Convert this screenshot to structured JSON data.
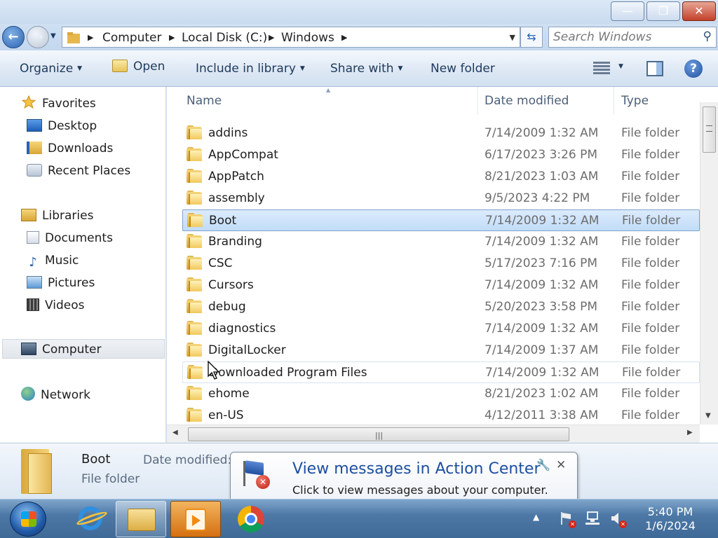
{
  "titlebar": {
    "minimize_label": "—",
    "maximize_label": "❐",
    "close_label": "✕"
  },
  "address": {
    "back_glyph": "←",
    "forward_glyph": "→",
    "crumbs": [
      "Computer",
      "Local Disk (C:)",
      "Windows"
    ],
    "search_placeholder": "Search Windows"
  },
  "toolbar": {
    "organize": "Organize",
    "open": "Open",
    "include_in_library": "Include in library",
    "share_with": "Share with",
    "new_folder": "New folder",
    "help": "?"
  },
  "nav": {
    "favorites": "Favorites",
    "desktop": "Desktop",
    "downloads": "Downloads",
    "recent_places": "Recent Places",
    "libraries": "Libraries",
    "documents": "Documents",
    "music": "Music",
    "pictures": "Pictures",
    "videos": "Videos",
    "computer": "Computer",
    "network": "Network"
  },
  "columns": {
    "name": "Name",
    "date_modified": "Date modified",
    "type": "Type"
  },
  "files": [
    {
      "name": "addins",
      "date": "7/14/2009 1:32 AM",
      "type": "File folder"
    },
    {
      "name": "AppCompat",
      "date": "6/17/2023 3:26 PM",
      "type": "File folder"
    },
    {
      "name": "AppPatch",
      "date": "8/21/2023 1:03 AM",
      "type": "File folder"
    },
    {
      "name": "assembly",
      "date": "9/5/2023 4:22 PM",
      "type": "File folder"
    },
    {
      "name": "Boot",
      "date": "7/14/2009 1:32 AM",
      "type": "File folder"
    },
    {
      "name": "Branding",
      "date": "7/14/2009 1:32 AM",
      "type": "File folder"
    },
    {
      "name": "CSC",
      "date": "5/17/2023 7:16 PM",
      "type": "File folder"
    },
    {
      "name": "Cursors",
      "date": "7/14/2009 1:32 AM",
      "type": "File folder"
    },
    {
      "name": "debug",
      "date": "5/20/2023 3:58 PM",
      "type": "File folder"
    },
    {
      "name": "diagnostics",
      "date": "7/14/2009 1:32 AM",
      "type": "File folder"
    },
    {
      "name": "DigitalLocker",
      "date": "7/14/2009 1:37 AM",
      "type": "File folder"
    },
    {
      "name": "Downloaded Program Files",
      "date": "7/14/2009 1:32 AM",
      "type": "File folder"
    },
    {
      "name": "ehome",
      "date": "8/21/2023 1:02 AM",
      "type": "File folder"
    },
    {
      "name": "en-US",
      "date": "4/12/2011 3:38 AM",
      "type": "File folder"
    }
  ],
  "selected_index": 4,
  "hover_index": 11,
  "details": {
    "name": "Boot",
    "type": "File folder",
    "date_label": "Date modified:"
  },
  "balloon": {
    "title": "View messages in Action Center",
    "text": "Click to view messages about your computer.",
    "close_glyph": "✕"
  },
  "taskbar": {
    "time": "5:40 PM",
    "date": "1/6/2024",
    "tray_up_glyph": "▲"
  },
  "colors": {
    "selection": "#c1dcf8",
    "link_blue": "#1d4fa0",
    "taskbar": "#4d78a6"
  }
}
